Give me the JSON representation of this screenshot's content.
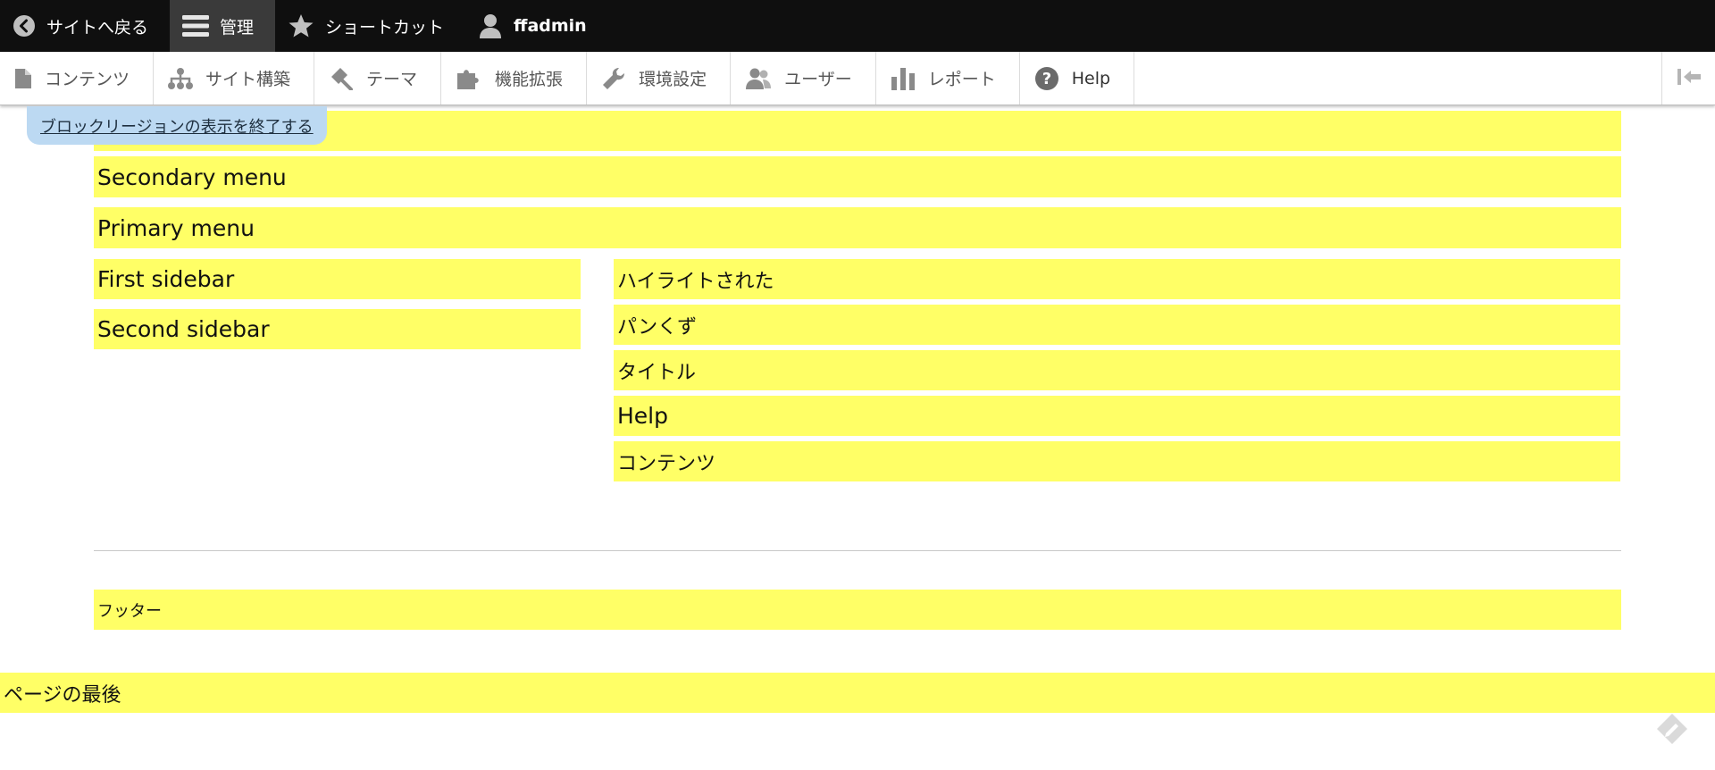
{
  "toolbar": {
    "back_to_site": "サイトへ戻る",
    "manage": "管理",
    "shortcuts": "ショートカット",
    "user": "ffadmin"
  },
  "tray": {
    "items": [
      {
        "label": "コンテンツ",
        "icon": "file-icon"
      },
      {
        "label": "サイト構築",
        "icon": "sitemap-icon"
      },
      {
        "label": "テーマ",
        "icon": "paintbrush-icon"
      },
      {
        "label": "機能拡張",
        "icon": "puzzle-icon"
      },
      {
        "label": "環境設定",
        "icon": "wrench-icon"
      },
      {
        "label": "ユーザー",
        "icon": "users-icon"
      },
      {
        "label": "レポート",
        "icon": "bar-chart-icon"
      },
      {
        "label": "Help",
        "icon": "question-icon"
      }
    ],
    "toggle_icon": "collapse-left-icon"
  },
  "exit_block_regions": "ブロックリージョンの表示を終了する",
  "regions": {
    "header": "",
    "secondary_menu": "Secondary menu",
    "primary_menu": "Primary menu",
    "first_sidebar": "First sidebar",
    "second_sidebar": "Second sidebar",
    "highlighted": "ハイライトされた",
    "breadcrumb": "パンくず",
    "title": "タイトル",
    "help": "Help",
    "content": "コンテンツ",
    "footer": "フッター",
    "page_bottom": "ページの最後"
  },
  "colors": {
    "toolbar_bg": "#0f0f0f",
    "active_tab_bg": "#3a3a3a",
    "region_bg": "#ffff66",
    "exit_button_bg": "#bcd9f2"
  }
}
